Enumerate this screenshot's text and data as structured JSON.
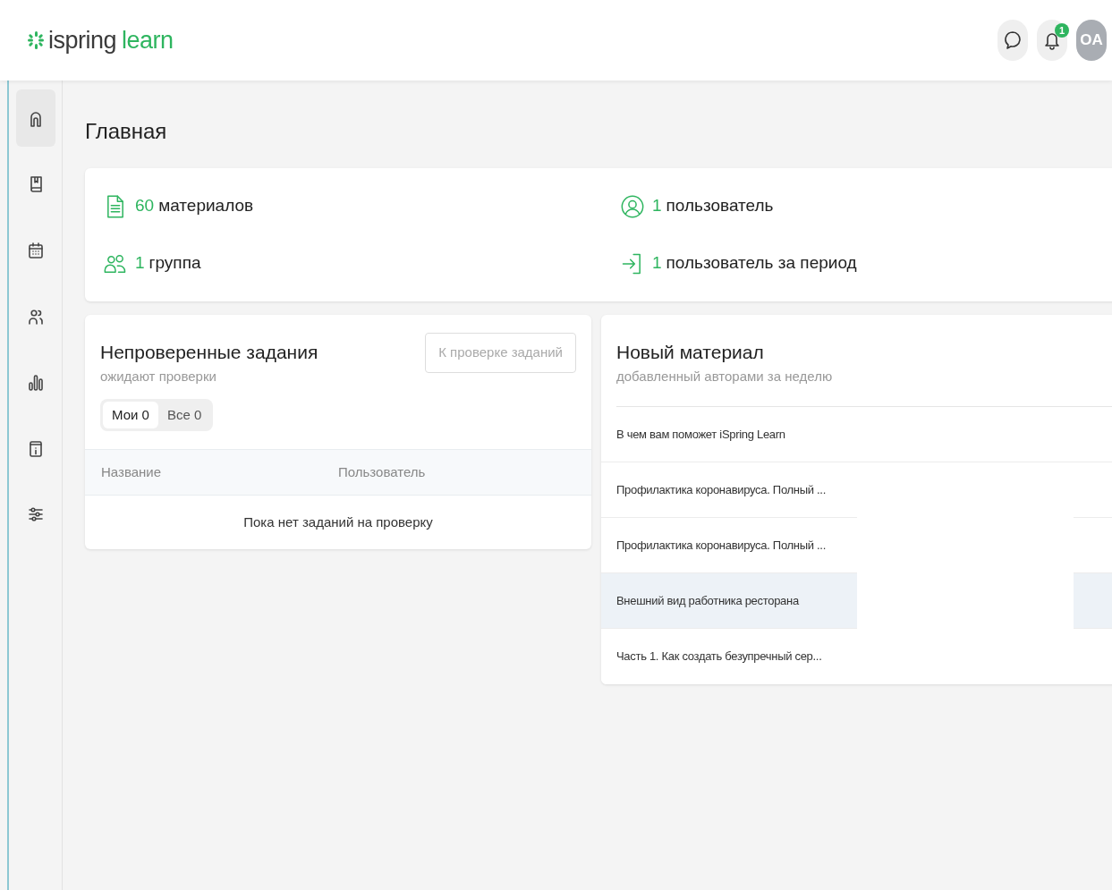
{
  "header": {
    "logo": {
      "brand": "ispring",
      "product": "learn"
    },
    "notification_badge": "1",
    "avatar": "OA"
  },
  "sidebar": {
    "items": [
      {
        "selected": true
      },
      {
        "selected": false
      },
      {
        "selected": false
      },
      {
        "selected": false
      },
      {
        "selected": false
      },
      {
        "selected": false
      },
      {
        "selected": false
      }
    ]
  },
  "page_title": "Главная",
  "stats": [
    {
      "count": "60",
      "label": "материалов"
    },
    {
      "count": "1",
      "label": "пользователь"
    },
    {
      "count": "1",
      "label": "группа"
    },
    {
      "count": "1",
      "label": "пользователь за период"
    }
  ],
  "pending_tasks": {
    "title": "Непроверенные задания",
    "subtitle": "ожидают проверки",
    "button": "К проверке заданий",
    "tabs": [
      {
        "label": "Мои",
        "count": "0",
        "selected": true
      },
      {
        "label": "Все",
        "count": "0",
        "selected": false
      }
    ],
    "columns": [
      "Название",
      "Пользователь"
    ],
    "empty_message": "Пока нет заданий на проверку"
  },
  "new_material": {
    "title": "Новый материал",
    "subtitle": "добавленный авторами за неделю",
    "items": [
      {
        "title": "В чем вам поможет iSpring Learn",
        "highlighted": false
      },
      {
        "title": "Профилактика коронавируса. Полный ...",
        "highlighted": false
      },
      {
        "title": "Профилактика коронавируса. Полный ...",
        "highlighted": false
      },
      {
        "title": "Внешний вид работника ресторана",
        "highlighted": true
      },
      {
        "title": "Часть 1. Как создать безупречный сер...",
        "highlighted": false
      }
    ]
  }
}
